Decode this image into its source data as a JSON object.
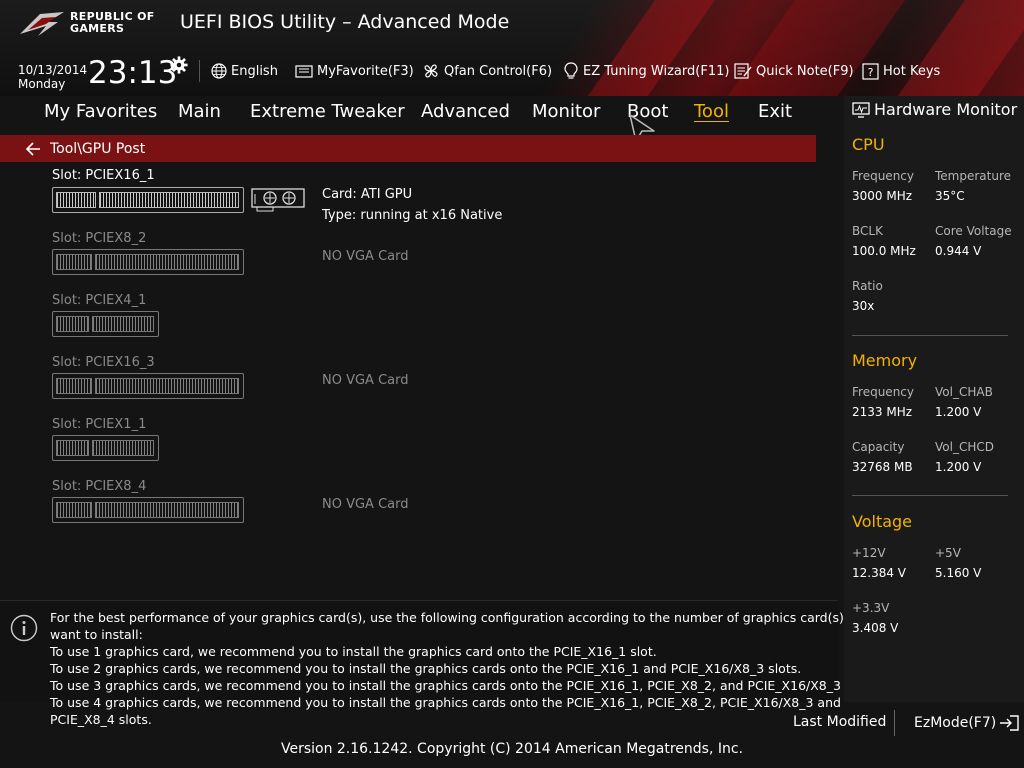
{
  "header": {
    "logo_line1": "REPUBLIC OF",
    "logo_line2": "GAMERS",
    "title": "UEFI BIOS Utility – Advanced Mode",
    "date": "10/13/2014",
    "day": "Monday",
    "time": "23:13",
    "tools": {
      "language": "English",
      "favorite": "MyFavorite(F3)",
      "qfan": "Qfan Control(F6)",
      "ez_tuning": "EZ Tuning Wizard(F11)",
      "quick_note": "Quick Note(F9)",
      "hot_keys": "Hot Keys"
    }
  },
  "nav": {
    "items": [
      "My Favorites",
      "Main",
      "Extreme Tweaker",
      "Advanced",
      "Monitor",
      "Boot",
      "Tool",
      "Exit"
    ],
    "active": "Tool"
  },
  "breadcrumb": "Tool\\GPU Post",
  "slots": [
    {
      "label": "Slot: PCIEX16_1",
      "card": "Card: ATI GPU",
      "type": "Type: running at x16 Native"
    },
    {
      "label": "Slot: PCIEX8_2",
      "status": "NO VGA Card"
    },
    {
      "label": "Slot: PCIEX4_1"
    },
    {
      "label": "Slot: PCIEX16_3",
      "status": "NO VGA Card"
    },
    {
      "label": "Slot: PCIEX1_1"
    },
    {
      "label": "Slot: PCIEX8_4",
      "status": "NO VGA Card"
    }
  ],
  "info": {
    "lines": [
      "For the best performance of your graphics card(s), use the following configuration according to the number of graphics card(s) you",
      "want to install:",
      "To use 1 graphics card, we recommend you to install  the graphics card onto the PCIE_X16_1 slot.",
      "To use 2 graphics cards, we recommend you to install the graphics cards onto the PCIE_X16_1 and PCIE_X16/X8_3 slots.",
      "To use 3 graphics cards, we recommend you to install the graphics cards onto the PCIE_X16_1, PCIE_X8_2, and PCIE_X16/X8_3 slots.",
      "To use 4 graphics cards, we recommend you to install the graphics cards onto the PCIE_X16_1, PCIE_X8_2, PCIE_X16/X8_3 and",
      "PCIE_X8_4 slots."
    ]
  },
  "hw_monitor": {
    "title": "Hardware Monitor",
    "cpu": {
      "heading": "CPU",
      "frequency_label": "Frequency",
      "frequency": "3000 MHz",
      "temperature_label": "Temperature",
      "temperature": "35°C",
      "bclk_label": "BCLK",
      "bclk": "100.0 MHz",
      "core_voltage_label": "Core Voltage",
      "core_voltage": "0.944 V",
      "ratio_label": "Ratio",
      "ratio": "30x"
    },
    "memory": {
      "heading": "Memory",
      "frequency_label": "Frequency",
      "frequency": "2133 MHz",
      "vol_chab_label": "Vol_CHAB",
      "vol_chab": "1.200 V",
      "capacity_label": "Capacity",
      "capacity": "32768 MB",
      "vol_chcd_label": "Vol_CHCD",
      "vol_chcd": "1.200 V"
    },
    "voltage": {
      "heading": "Voltage",
      "v12_label": "+12V",
      "v12": "12.384 V",
      "v5_label": "+5V",
      "v5": "5.160 V",
      "v33_label": "+3.3V",
      "v33": "3.408 V"
    }
  },
  "footer": {
    "last_modified": "Last Modified",
    "ezmode": "EzMode(F7)",
    "version": "Version 2.16.1242. Copyright (C) 2014 American Megatrends, Inc."
  },
  "colors": {
    "accent": "#f2b200",
    "brand_red": "#7a1214"
  }
}
